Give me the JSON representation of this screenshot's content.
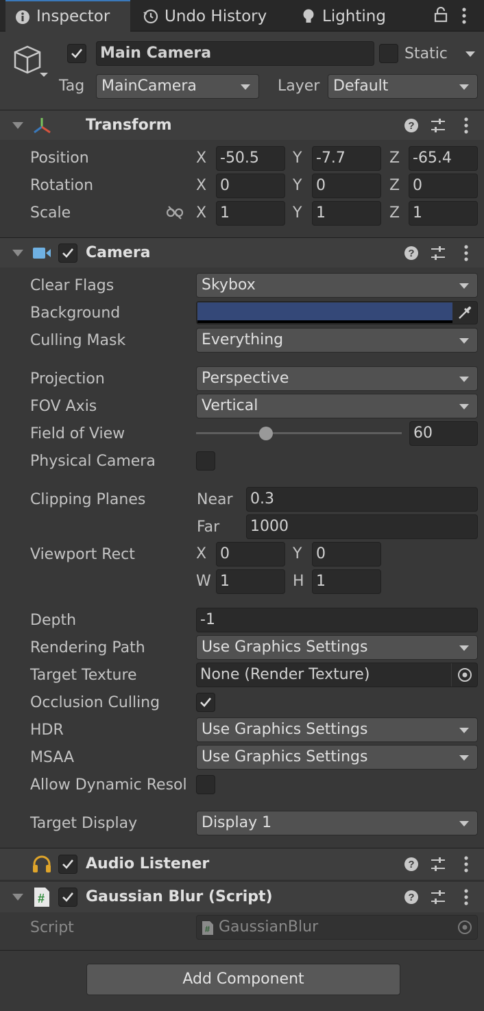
{
  "tabs": [
    {
      "label": "Inspector",
      "icon": "info-icon",
      "active": true
    },
    {
      "label": "Undo History",
      "icon": "history-icon",
      "active": false
    },
    {
      "label": "Lighting",
      "icon": "lightbulb-icon",
      "active": false
    }
  ],
  "object": {
    "name": "Main Camera",
    "active": true,
    "static_label": "Static",
    "static": false,
    "tag_label": "Tag",
    "tag": "MainCamera",
    "layer_label": "Layer",
    "layer": "Default"
  },
  "transform": {
    "title": "Transform",
    "rows": [
      {
        "label": "Position",
        "x": "-50.5",
        "y": "-7.7",
        "z": "-65.4"
      },
      {
        "label": "Rotation",
        "x": "0",
        "y": "0",
        "z": "0"
      },
      {
        "label": "Scale",
        "x": "1",
        "y": "1",
        "z": "1"
      }
    ],
    "axis": {
      "x": "X",
      "y": "Y",
      "z": "Z"
    }
  },
  "camera": {
    "title": "Camera",
    "enabled": true,
    "clear_flags_label": "Clear Flags",
    "clear_flags": "Skybox",
    "background_label": "Background",
    "background_color": "#344878",
    "culling_mask_label": "Culling Mask",
    "culling_mask": "Everything",
    "projection_label": "Projection",
    "projection": "Perspective",
    "fov_axis_label": "FOV Axis",
    "fov_axis": "Vertical",
    "fov_label": "Field of View",
    "fov": "60",
    "fov_slider_fraction": 0.34,
    "physical_label": "Physical Camera",
    "physical": false,
    "clipping_label": "Clipping Planes",
    "near_label": "Near",
    "near": "0.3",
    "far_label": "Far",
    "far": "1000",
    "viewport_label": "Viewport Rect",
    "vp_x_label": "X",
    "vp_x": "0",
    "vp_y_label": "Y",
    "vp_y": "0",
    "vp_w_label": "W",
    "vp_w": "1",
    "vp_h_label": "H",
    "vp_h": "1",
    "depth_label": "Depth",
    "depth": "-1",
    "rendering_path_label": "Rendering Path",
    "rendering_path": "Use Graphics Settings",
    "target_texture_label": "Target Texture",
    "target_texture": "None (Render Texture)",
    "occlusion_label": "Occlusion Culling",
    "occlusion": true,
    "hdr_label": "HDR",
    "hdr": "Use Graphics Settings",
    "msaa_label": "MSAA",
    "msaa": "Use Graphics Settings",
    "dynres_label": "Allow Dynamic Resol",
    "dynres": false,
    "target_display_label": "Target Display",
    "target_display": "Display 1"
  },
  "audio_listener": {
    "title": "Audio Listener",
    "enabled": true
  },
  "gaussian": {
    "title": "Gaussian Blur (Script)",
    "enabled": true,
    "script_label": "Script",
    "script": "GaussianBlur"
  },
  "add_component": "Add Component",
  "colors": {
    "accent": "#3a79bb",
    "panel": "#383838",
    "header": "#3e3e3e"
  }
}
